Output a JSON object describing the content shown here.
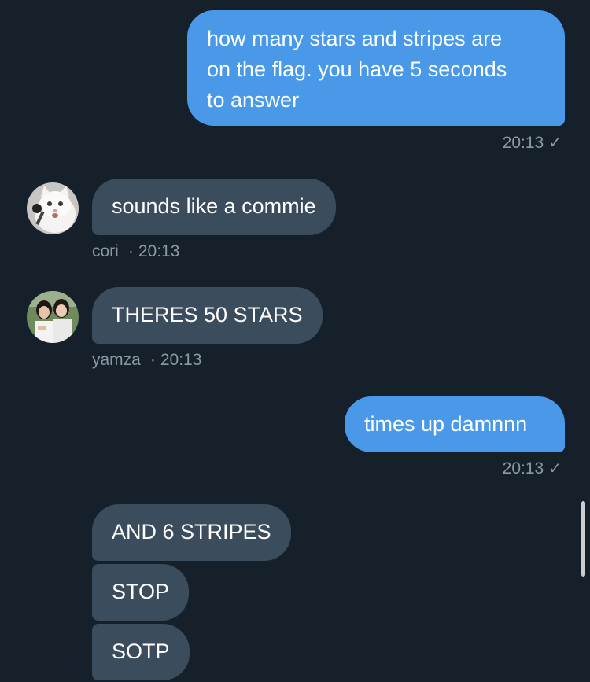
{
  "messages": {
    "m1": {
      "text_lines": [
        "how many stars and stripes are",
        "on the flag. you have 5 seconds",
        "to answer"
      ],
      "time": "20:13",
      "status_icon": "check-icon"
    },
    "m2": {
      "text": "sounds like a commie",
      "sender": "cori",
      "time": "20:13",
      "avatar": "white-kitten-microphone"
    },
    "m3": {
      "text": "THERES 50 STARS",
      "sender": "yamza",
      "time": "20:13",
      "avatar": "two-girls-photo"
    },
    "m4": {
      "text": "times up damnnn",
      "time": "20:13",
      "status_icon": "check-icon"
    },
    "m5": {
      "text": "AND 6 STRIPES"
    },
    "m6": {
      "text": "STOP"
    },
    "m7": {
      "text": "SOTP"
    }
  },
  "separator": "·",
  "check_glyph": "✓",
  "colors": {
    "background": "#16202b",
    "outgoing_bubble": "#4a99e9",
    "incoming_bubble": "#3b4c5c",
    "meta_text": "#8b98a5"
  }
}
